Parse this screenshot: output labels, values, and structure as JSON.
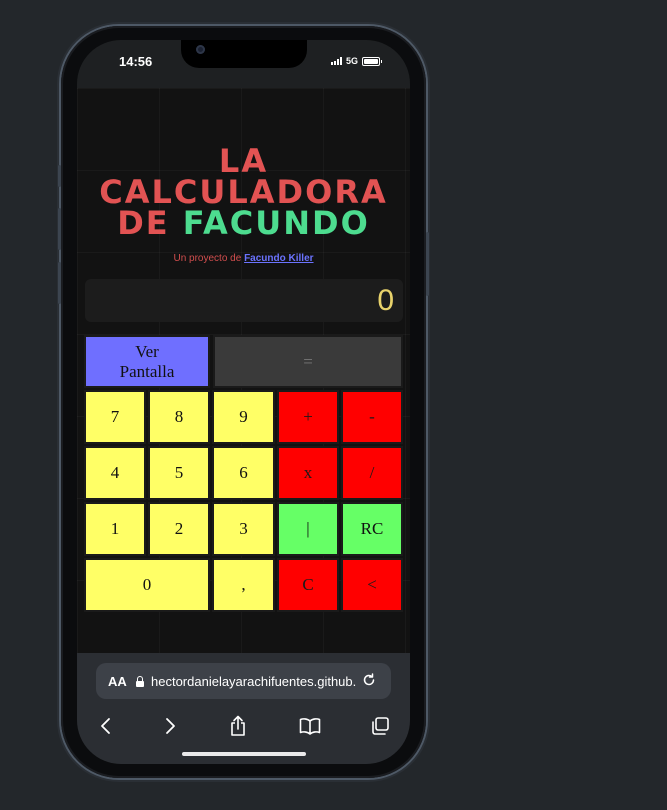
{
  "status": {
    "time": "14:56",
    "network": "5G"
  },
  "app": {
    "title_line1": "LA",
    "title_line2": "CALCULADORA",
    "title_de": "DE",
    "title_facundo": "FACUNDO",
    "subtitle_prefix": "Un proyecto de",
    "subtitle_link": "Facundo Killer",
    "display_value": "0"
  },
  "buttons": {
    "ver_pantalla": "Ver Pantalla",
    "equals": "=",
    "seven": "7",
    "eight": "8",
    "nine": "9",
    "plus": "+",
    "minus": "-",
    "four": "4",
    "five": "5",
    "six": "6",
    "multiply": "x",
    "divide": "/",
    "one": "1",
    "two": "2",
    "three": "3",
    "root": "|",
    "rc": "RC",
    "zero": "0",
    "comma": ",",
    "clear": "C",
    "back": "<"
  },
  "browser": {
    "aa_label": "AA",
    "url": "hectordanielayarachifuentes.github.io"
  },
  "colors": {
    "title_red": "#e25353",
    "title_green": "#4ddc8f",
    "link": "#6b73ff",
    "digit_yellow": "#ffff66",
    "op_red": "#ff0000",
    "func_green": "#66ff66",
    "view_blue": "#6f6fff",
    "display_text": "#e8d26b"
  },
  "icons": [
    "signal-icon",
    "battery-icon",
    "lock-icon",
    "reload-icon",
    "back-icon",
    "forward-icon",
    "share-icon",
    "bookmarks-icon",
    "tabs-icon"
  ]
}
